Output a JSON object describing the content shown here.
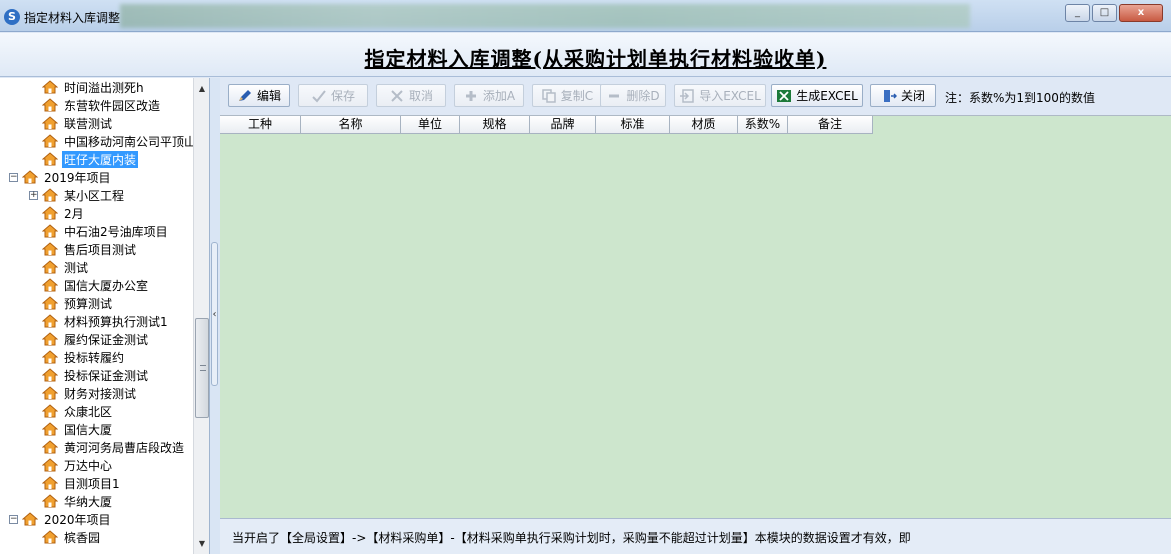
{
  "window": {
    "title": "指定材料入库调整",
    "min_label": "_",
    "max_label": "□",
    "close_label": "x"
  },
  "header": {
    "title": "指定材料入库调整(从采购计划单执行材料验收单)"
  },
  "sidebar": {
    "items": [
      {
        "label": "时间溢出测死h",
        "level": 2
      },
      {
        "label": "东营软件园区改造",
        "level": 2
      },
      {
        "label": "联营测试",
        "level": 2
      },
      {
        "label": "中国移动河南公司平顶山",
        "level": 2
      },
      {
        "label": "旺仔大厦内装",
        "level": 2,
        "selected": true
      },
      {
        "label": "2019年项目",
        "level": 0,
        "toggle": "−"
      },
      {
        "label": "某小区工程",
        "level": 1,
        "toggle": "+"
      },
      {
        "label": "2月",
        "level": 2
      },
      {
        "label": "中石油2号油库项目",
        "level": 2
      },
      {
        "label": "售后项目测试",
        "level": 2
      },
      {
        "label": "测试",
        "level": 2
      },
      {
        "label": "国信大厦办公室",
        "level": 2
      },
      {
        "label": "预算测试",
        "level": 2
      },
      {
        "label": "材料预算执行测试1",
        "level": 2
      },
      {
        "label": "履约保证金测试",
        "level": 2
      },
      {
        "label": "投标转履约",
        "level": 2
      },
      {
        "label": "投标保证金测试",
        "level": 2
      },
      {
        "label": "财务对接测试",
        "level": 2
      },
      {
        "label": "众康北区",
        "level": 2
      },
      {
        "label": "国信大厦",
        "level": 2
      },
      {
        "label": "黄河河务局曹店段改造",
        "level": 2
      },
      {
        "label": "万达中心",
        "level": 2
      },
      {
        "label": "目测项目1",
        "level": 2
      },
      {
        "label": "华纳大厦",
        "level": 2
      },
      {
        "label": "2020年项目",
        "level": 0,
        "toggle": "−"
      },
      {
        "label": "槟香园",
        "level": 2
      }
    ]
  },
  "toolbar": {
    "edit": "编辑",
    "save": "保存",
    "cancel": "取消",
    "add": "添加A",
    "copy": "复制C",
    "delete": "删除D",
    "import_excel": "导入EXCEL",
    "export_excel": "生成EXCEL",
    "close": "关闭",
    "note": "注：系数%为1到100的数值"
  },
  "grid": {
    "columns": [
      "工种",
      "名称",
      "单位",
      "规格",
      "品牌",
      "标准",
      "材质",
      "系数%",
      "备注"
    ],
    "rows": []
  },
  "status": {
    "text": "当开启了【全局设置】->【材料采购单】-【材料采购单执行采购计划时，采购量不能超过计划量】本模块的数据设置才有效，即"
  },
  "colors": {
    "grid_bg": "#cde6cd",
    "selection": "#3399ff",
    "header_bg": "#dfe9f6"
  }
}
